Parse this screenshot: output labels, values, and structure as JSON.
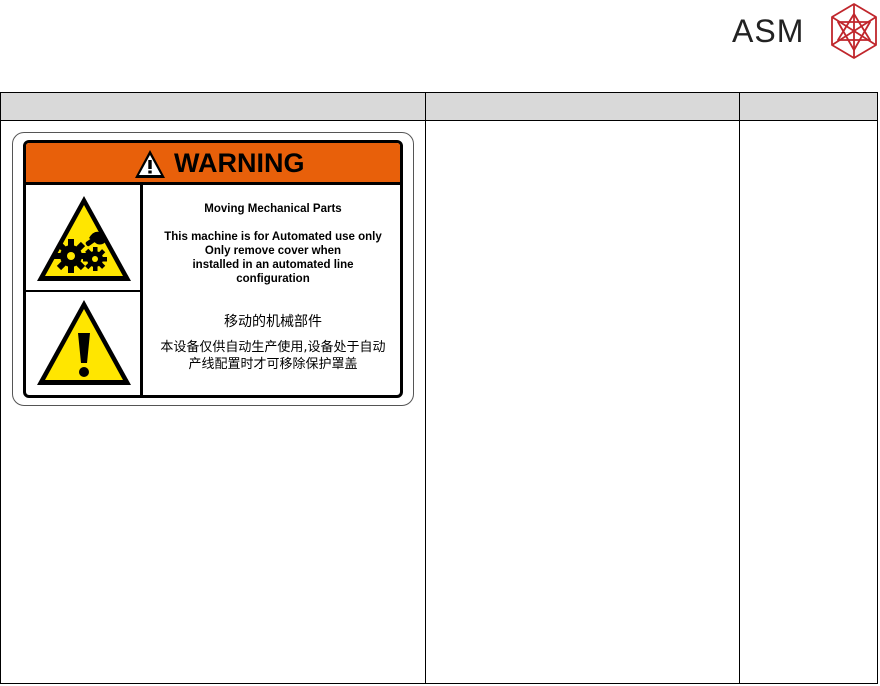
{
  "logo": {
    "text": "ASM",
    "mark_color": "#c0262c",
    "text_color": "#222222"
  },
  "table": {
    "header_color": "#d9d9d9"
  },
  "sign": {
    "banner_text": "WARNING",
    "banner_color": "#e8600a",
    "warning_triangle_color": "#ffe600",
    "title_en": "Moving Mechanical Parts",
    "body_en": "This machine is for Automated use only\nOnly remove cover when\ninstalled in an automated line\nconfiguration",
    "title_cn": "移动的机械部件",
    "body_cn": "本设备仅供自动生产使用,设备处于自动\n产线配置时才可移除保护罩盖",
    "icons": [
      "alert-icon",
      "moving-gears-hazard-icon",
      "general-warning-icon"
    ]
  }
}
